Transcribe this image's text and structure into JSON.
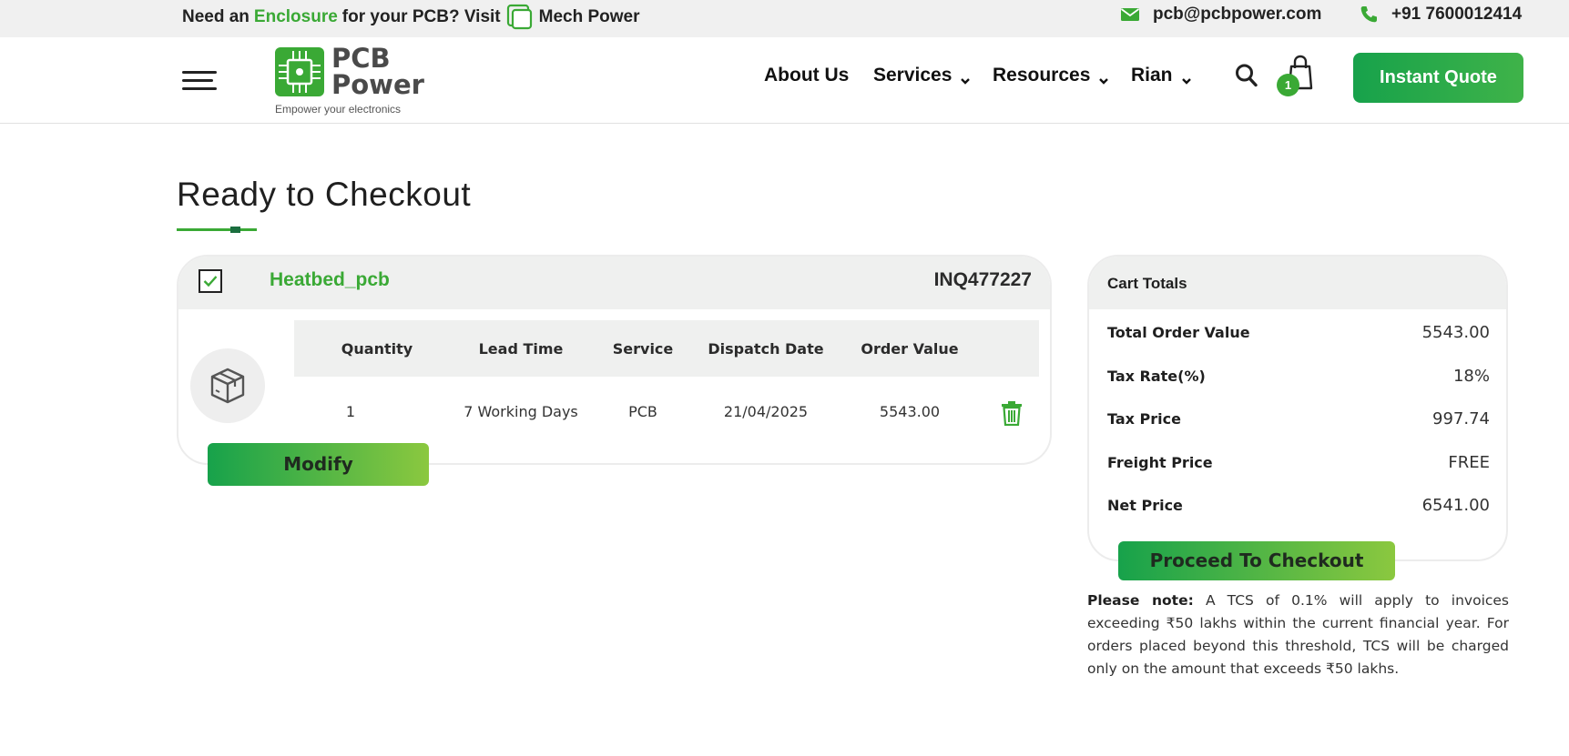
{
  "topbar": {
    "promo_prefix": "Need an",
    "promo_accent": "Enclosure",
    "promo_middle": "for your PCB? Visit",
    "promo_link": "Mech Power",
    "email": "pcb@pcbpower.com",
    "phone": "+91 7600012414"
  },
  "header": {
    "logo_brand": "PCB\nPower",
    "logo_tagline": "Empower your electronics",
    "nav": {
      "about": "About Us",
      "services": "Services",
      "resources": "Resources",
      "user": "Rian"
    },
    "cart_count": "1",
    "quote_button": "Instant Quote"
  },
  "page": {
    "title": "Ready to Checkout"
  },
  "order": {
    "product_name": "Heatbed_pcb",
    "inquiry_id": "INQ477227",
    "columns": [
      "Quantity",
      "Lead Time",
      "Service",
      "Dispatch Date",
      "Order Value"
    ],
    "row": {
      "quantity": "1",
      "lead_time": "7 Working Days",
      "service": "PCB",
      "dispatch_date": "21/04/2025",
      "order_value": "5543.00"
    },
    "modify_button": "Modify"
  },
  "cart_totals": {
    "title": "Cart Totals",
    "rows": [
      {
        "label": "Total Order Value",
        "value": "5543.00"
      },
      {
        "label": "Tax Rate(%)",
        "value": "18%"
      },
      {
        "label": "Tax Price",
        "value": "997.74"
      },
      {
        "label": "Freight Price",
        "value": "FREE"
      },
      {
        "label": "Net Price",
        "value": "6541.00"
      }
    ],
    "checkout_button": "Proceed To Checkout"
  },
  "note": {
    "label": "Please note:",
    "text": "A TCS of 0.1% will apply to invoices exceeding ₹50 lakhs within the current financial year. For orders placed beyond this threshold, TCS will be charged only on the amount that exceeds ₹50 lakhs."
  },
  "colors": {
    "accent": "#3aa935",
    "button_gradient_start": "#17a24b",
    "button_gradient_end": "#8bc83f",
    "panel_header": "#eff0ef"
  },
  "icons": [
    "mech-power-icon",
    "email-icon",
    "phone-icon",
    "menu-icon",
    "search-icon",
    "shopping-bag-icon",
    "chevron-down-icon",
    "checkmark-icon",
    "package-box-icon",
    "trash-icon"
  ]
}
